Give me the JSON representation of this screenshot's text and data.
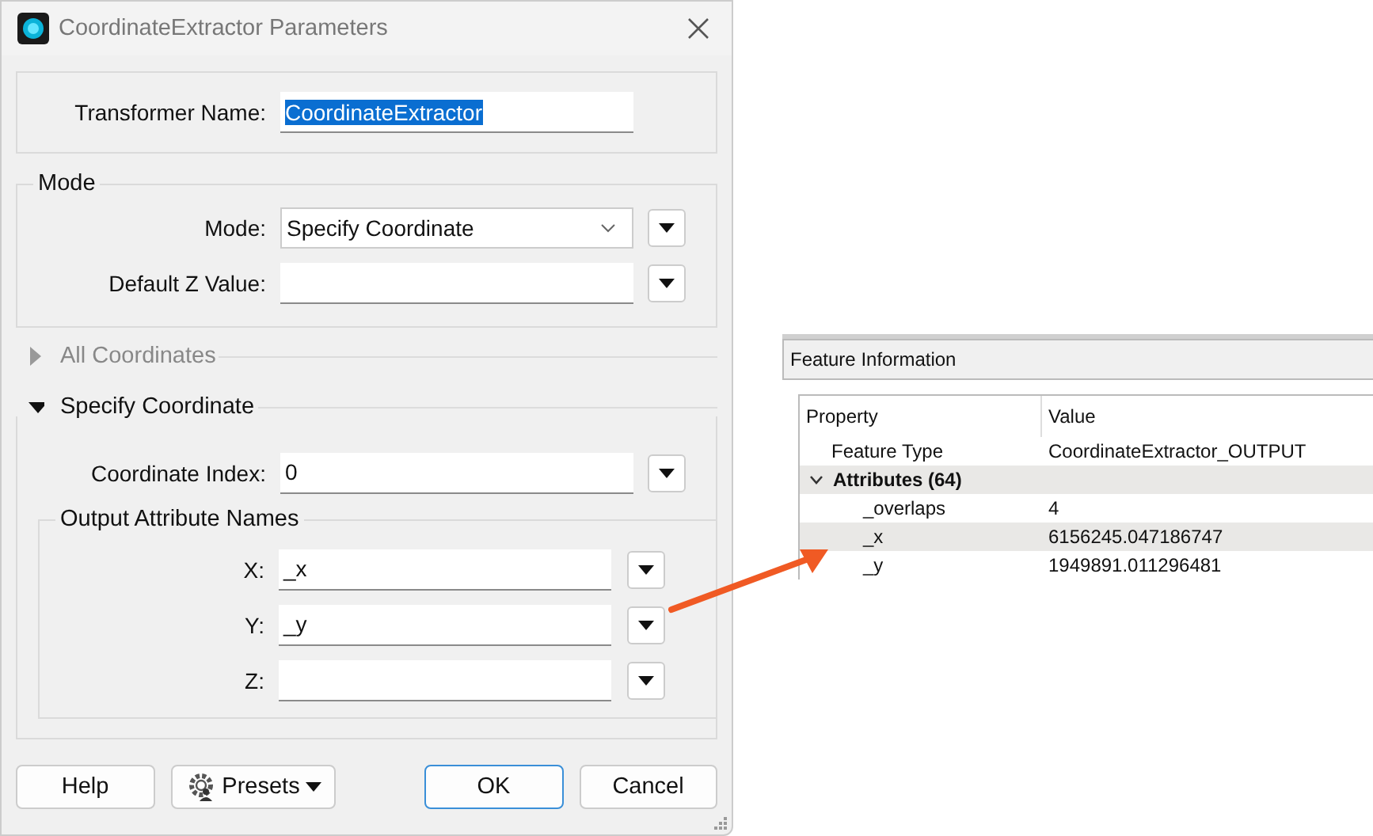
{
  "window": {
    "title": "CoordinateExtractor Parameters"
  },
  "transformer_name": {
    "label": "Transformer Name:",
    "value": "CoordinateExtractor",
    "highlighted": true
  },
  "mode_group": {
    "title": "Mode",
    "fields": [
      {
        "label": "Mode:",
        "kind": "dropdown",
        "value": "Specify Coordinate"
      },
      {
        "label": "Default Z Value:",
        "kind": "text"
      }
    ]
  },
  "sections": [
    {
      "title": "All Coordinates",
      "expanded": false
    },
    {
      "title": "Specify Coordinate",
      "expanded": true,
      "fields": [
        {
          "label": "Coordinate Index:",
          "value": "0"
        }
      ],
      "group": {
        "title": "Output Attribute Names",
        "fields": [
          {
            "label": "X:",
            "value": "_x"
          },
          {
            "label": "Y:",
            "value": "_y"
          },
          {
            "label": "Z:"
          }
        ]
      }
    }
  ],
  "buttons": [
    {
      "label": "Help",
      "kind": "plain"
    },
    {
      "label": "Presets",
      "kind": "menu"
    },
    {
      "label": "OK",
      "kind": "default"
    },
    {
      "label": "Cancel",
      "kind": "plain"
    }
  ],
  "feature_info": {
    "title": "Feature Information",
    "columns": [
      "Property",
      "Value"
    ],
    "rows": [
      {
        "property": "Feature Type",
        "value": "CoordinateExtractor_OUTPUT"
      },
      {
        "property": "Attributes (64)",
        "expanded": true,
        "children": [
          {
            "property": "_overlaps",
            "value": "4"
          },
          {
            "property": "_x",
            "value": "6156245.047186747"
          },
          {
            "property": "_y",
            "value": "1949891.011296481"
          }
        ]
      }
    ]
  }
}
